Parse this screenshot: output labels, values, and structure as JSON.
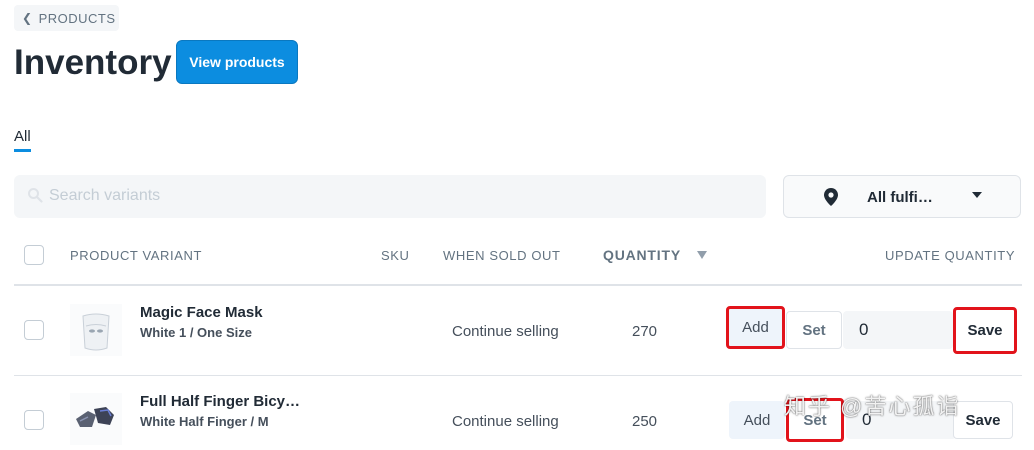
{
  "breadcrumb": {
    "label": "PRODUCTS"
  },
  "header": {
    "title": "Inventory",
    "view_products_label": "View products"
  },
  "tabs": [
    {
      "label": "All",
      "active": true
    }
  ],
  "search": {
    "placeholder": "Search variants"
  },
  "location_filter": {
    "label": "All fulfi…"
  },
  "table": {
    "columns": {
      "product_variant": "PRODUCT VARIANT",
      "sku": "SKU",
      "when_sold_out": "WHEN SOLD OUT",
      "quantity": "QUANTITY",
      "update_quantity": "UPDATE QUANTITY"
    },
    "rows": [
      {
        "name": "Magic Face Mask",
        "variant": "White 1 / One Size",
        "sku": "",
        "when_sold_out": "Continue selling",
        "quantity": "270",
        "add_label": "Add",
        "set_label": "Set",
        "update_value": "0",
        "save_label": "Save"
      },
      {
        "name": "Full Half Finger Bicy…",
        "variant": "White Half Finger / M",
        "sku": "",
        "when_sold_out": "Continue selling",
        "quantity": "250",
        "add_label": "Add",
        "set_label": "Set",
        "update_value": "0",
        "save_label": "Save"
      }
    ]
  },
  "watermark": {
    "text": "知乎 @苦心孤诣"
  },
  "colors": {
    "primary": "#0c8de0",
    "highlight": "#e2131b"
  },
  "icons": {
    "back": "chevron-left-icon",
    "search": "search-icon",
    "location": "location-pin-icon",
    "dropdown": "caret-down-icon",
    "sort": "sort-caret-icon"
  }
}
